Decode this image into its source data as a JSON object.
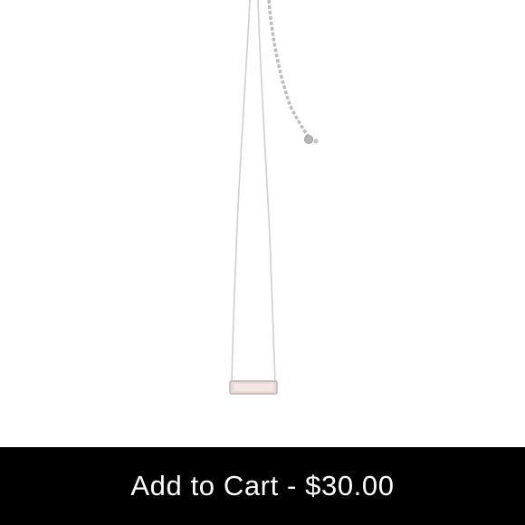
{
  "cart_button": {
    "label": "Add to Cart - $30.00",
    "background_color": "#000000",
    "text_color": "#ffffff"
  },
  "product_image": {
    "subject": "necklace-image"
  }
}
